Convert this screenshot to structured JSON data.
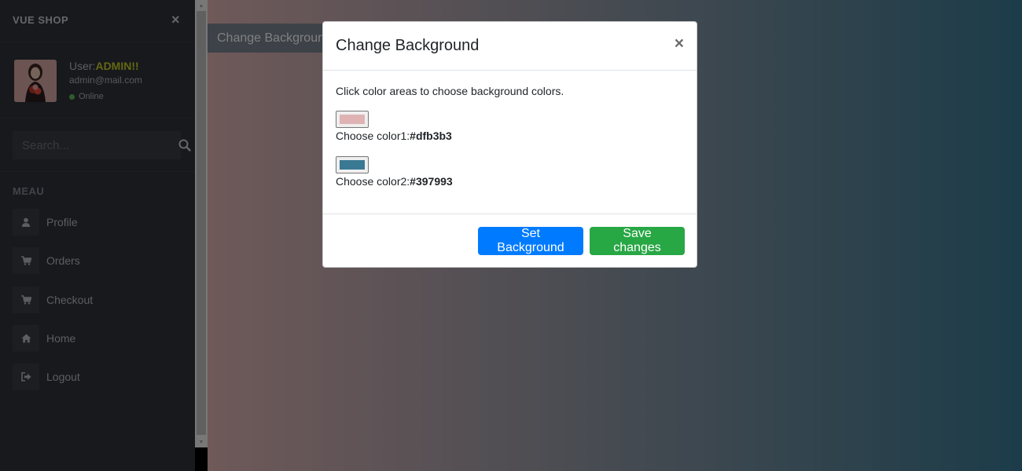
{
  "sidebar": {
    "brand": "VUE SHOP",
    "close_glyph": "×",
    "user": {
      "label_prefix": "User:",
      "name": "ADMIN!!",
      "email": "admin@mail.com",
      "status": "Online",
      "status_color": "#5cb85c",
      "name_color": "#c9cf27"
    },
    "search": {
      "placeholder": "Search..."
    },
    "menu_title": "MEAU",
    "items": [
      {
        "label": "Profile",
        "icon": "user-icon"
      },
      {
        "label": "Orders",
        "icon": "cart-icon"
      },
      {
        "label": "Checkout",
        "icon": "cart-icon"
      },
      {
        "label": "Home",
        "icon": "home-icon"
      },
      {
        "label": "Logout",
        "icon": "sign-out-icon"
      }
    ]
  },
  "main": {
    "change_background_label": "Change Background",
    "gradient": {
      "color1": "#dfb3b3",
      "color2": "#397993"
    }
  },
  "modal": {
    "title": "Change Background",
    "close_glyph": "×",
    "description": "Click color areas to choose background colors.",
    "color1": {
      "label": "Choose color1:",
      "value": "#dfb3b3"
    },
    "color2": {
      "label": "Choose color2:",
      "value": "#397993"
    },
    "set_button": "Set Background",
    "save_button": "Save changes",
    "set_color": "#007bff",
    "save_color": "#28a745"
  }
}
